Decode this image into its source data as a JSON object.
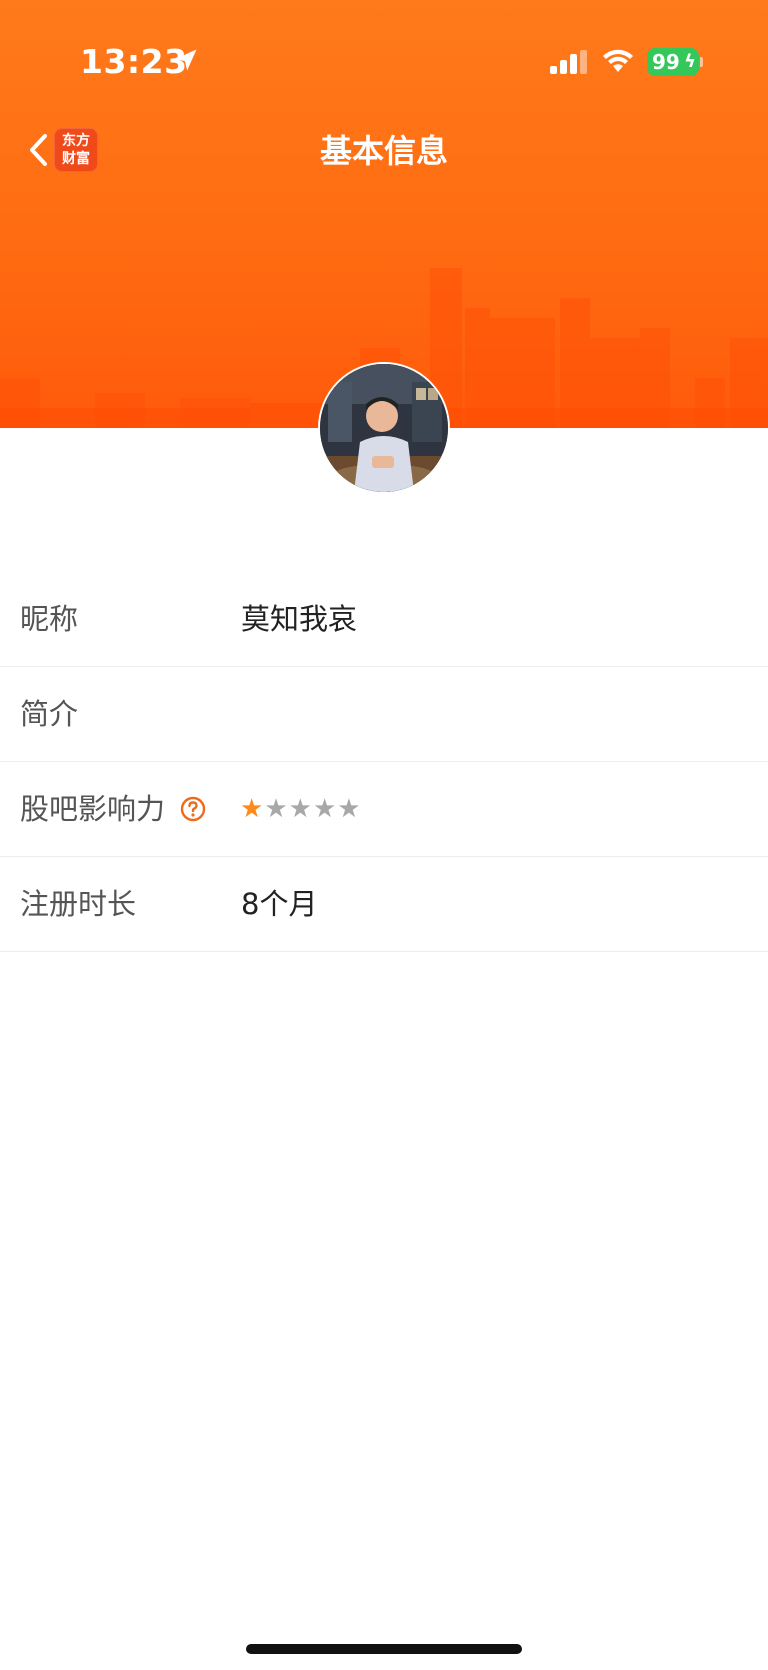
{
  "status_bar": {
    "time": "13:23",
    "battery_level": "99"
  },
  "nav": {
    "title": "基本信息",
    "logo_line1": "东方",
    "logo_line2": "财富"
  },
  "profile": {
    "rows": [
      {
        "label": "昵称",
        "value": "莫知我哀"
      },
      {
        "label": "简介",
        "value": ""
      },
      {
        "label": "股吧影响力",
        "rating": 1,
        "rating_max": 5
      },
      {
        "label": "注册时长",
        "value": "8个月"
      }
    ]
  },
  "colors": {
    "header_orange": "#ff6c12",
    "star_active": "#ff8a1c",
    "star_inactive": "#a8a8a8",
    "battery_green": "#34c759"
  }
}
